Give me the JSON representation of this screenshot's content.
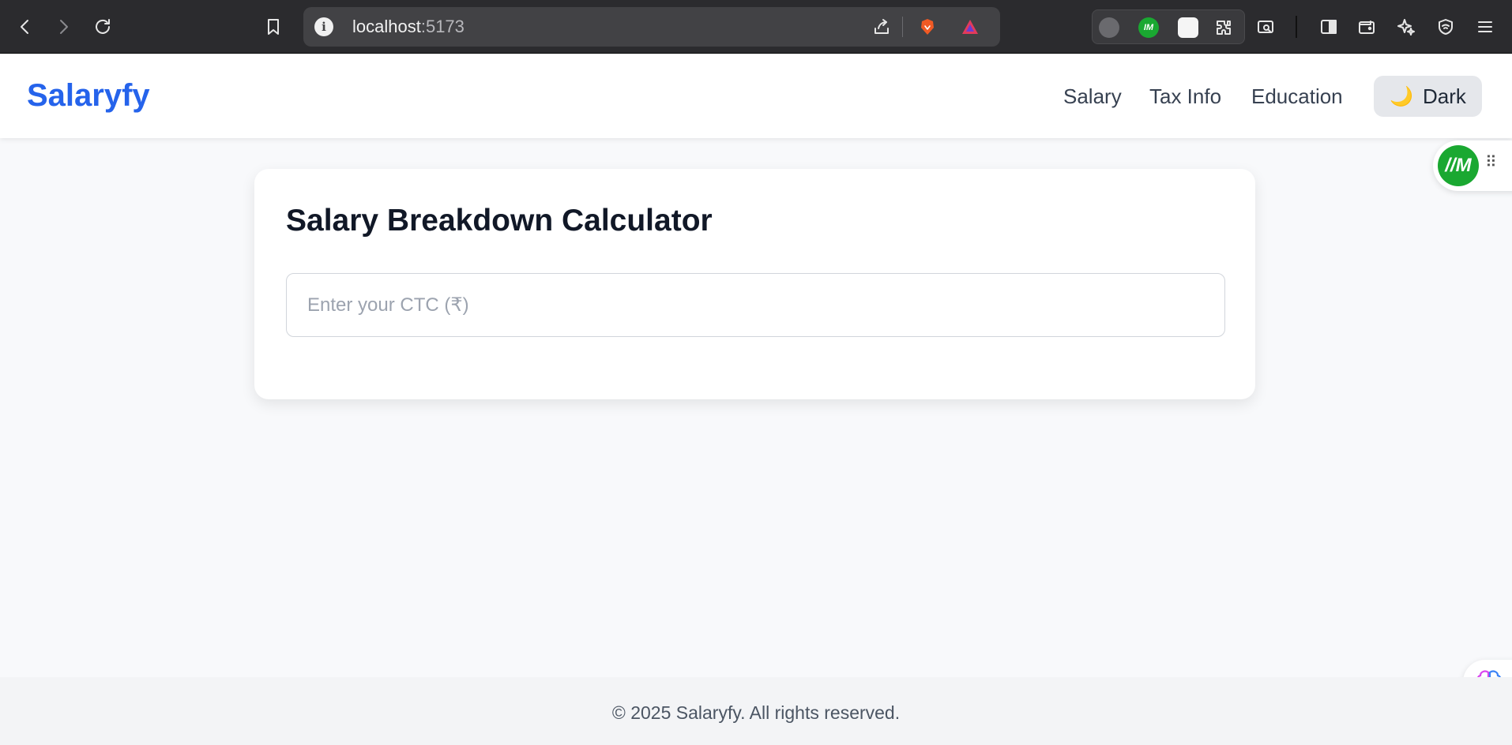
{
  "browser": {
    "url_host": "localhost",
    "url_port": ":5173"
  },
  "app": {
    "brand": "Salaryfy",
    "nav": [
      {
        "label": "Salary"
      },
      {
        "label": "Tax Info"
      },
      {
        "label": "Education"
      }
    ],
    "theme_toggle": {
      "icon": "🌙",
      "label": "Dark"
    }
  },
  "calculator": {
    "title": "Salary Breakdown Calculator",
    "ctc_input": {
      "value": "",
      "placeholder": "Enter your CTC (₹)"
    }
  },
  "widgets": {
    "im_badge": "//M",
    "drag_handle": "⠿"
  },
  "footer": {
    "text": "© 2025 Salaryfy. All rights reserved."
  },
  "colors": {
    "brand": "#2563eb",
    "im_green": "#1aa831",
    "brave_orange": "#f15a24"
  }
}
